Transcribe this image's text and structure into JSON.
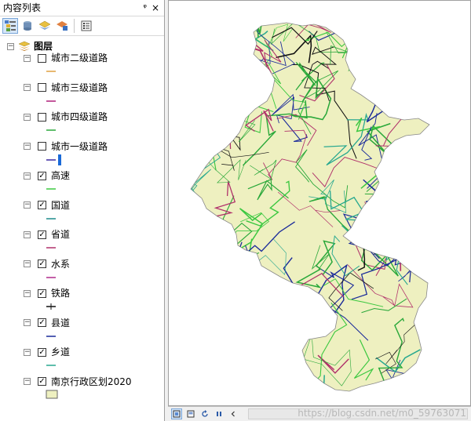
{
  "toc": {
    "title": "内容列表",
    "pin": "ᵠ",
    "close": "×",
    "root_label": "图层",
    "layers": [
      {
        "name": "城市二级道路",
        "checked": false,
        "color": "#e0a040",
        "sym": "line"
      },
      {
        "name": "城市三级道路",
        "checked": false,
        "color": "#b0207a",
        "sym": "line"
      },
      {
        "name": "城市四级道路",
        "checked": false,
        "color": "#2aa83a",
        "sym": "line"
      },
      {
        "name": "城市一级道路",
        "checked": false,
        "color": "#3a28a0",
        "sym": "line-bar"
      },
      {
        "name": "高速",
        "checked": true,
        "color": "#3cc840",
        "sym": "line"
      },
      {
        "name": "国道",
        "checked": true,
        "color": "#1e8a8a",
        "sym": "line"
      },
      {
        "name": "省道",
        "checked": true,
        "color": "#b0306a",
        "sym": "line"
      },
      {
        "name": "水系",
        "checked": true,
        "color": "#b02a8a",
        "sym": "line"
      },
      {
        "name": "铁路",
        "checked": true,
        "color": "#111111",
        "sym": "rail"
      },
      {
        "name": "县道",
        "checked": true,
        "color": "#1a2a9a",
        "sym": "line"
      },
      {
        "name": "乡道",
        "checked": true,
        "color": "#28a890",
        "sym": "line"
      },
      {
        "name": "南京行政区划2020",
        "checked": true,
        "color": "#eef0c0",
        "sym": "fill"
      }
    ]
  },
  "status": {
    "watermark": "https://blog.csdn.net/m0_59763071"
  },
  "map": {
    "fill": "#eef0c0",
    "road_colors": [
      "#1a2a9a",
      "#b0306a",
      "#2aa83a",
      "#111111",
      "#28a890",
      "#3cc840"
    ]
  }
}
